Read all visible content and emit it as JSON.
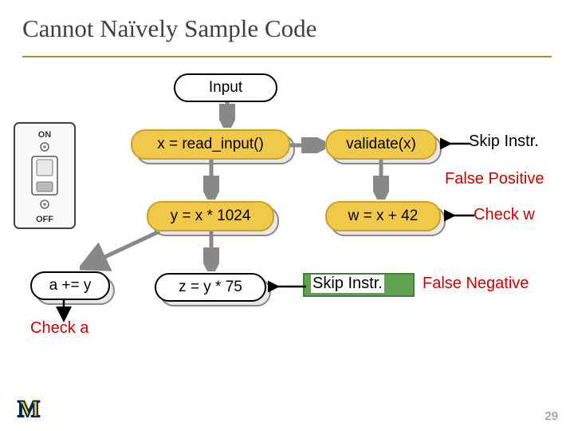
{
  "title": "Cannot Naïvely Sample Code",
  "nodes": {
    "input": "Input",
    "read_input": "x = read_input()",
    "validate": "validate(x)",
    "y_calc": "y = x * 1024",
    "w_calc": "w = x + 42",
    "a_plus": "a += y",
    "z_calc": "z = y * 75"
  },
  "labels": {
    "skip_instr_top": "Skip Instr.",
    "false_positive": "False Positive",
    "check_w": "Check w",
    "skip_instr_bot": "Skip Instr.",
    "false_negative": "False Negative",
    "check_a": "Check a"
  },
  "switch": {
    "on": "ON",
    "off": "OFF"
  },
  "page_number": "29"
}
